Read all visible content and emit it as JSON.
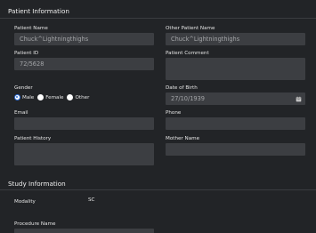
{
  "patient_info": {
    "section_title": "Patient Information",
    "patient_name_label": "Patient Name",
    "patient_name_value": "Chuck^Lightningthighs",
    "other_patient_name_label": "Other Patient Name",
    "other_patient_name_value": "Chuck^Lightningthighs",
    "patient_id_label": "Patient ID",
    "patient_id_value": "72/5628",
    "patient_comment_label": "Patient Comment",
    "patient_comment_value": "",
    "gender_label": "Gender",
    "gender_options": [
      "Male",
      "Female",
      "Other"
    ],
    "gender_selected": "Male",
    "dob_label": "Date of Birth",
    "dob_value": "27/10/1939",
    "email_label": "Email",
    "email_value": "",
    "phone_label": "Phone",
    "phone_value": "",
    "history_label": "Patient History",
    "history_value": "",
    "mother_name_label": "Mother Name",
    "mother_name_value": ""
  },
  "study_info": {
    "section_title": "Study Information",
    "modality_label": "Modality",
    "modality_value": "SC",
    "procedure_name_label": "Procedure Name"
  },
  "icons": {
    "calendar": "calendar-icon"
  },
  "colors": {
    "background": "#222427",
    "field_bg": "#3c3e42",
    "radio_accent": "#2f6fd6"
  }
}
